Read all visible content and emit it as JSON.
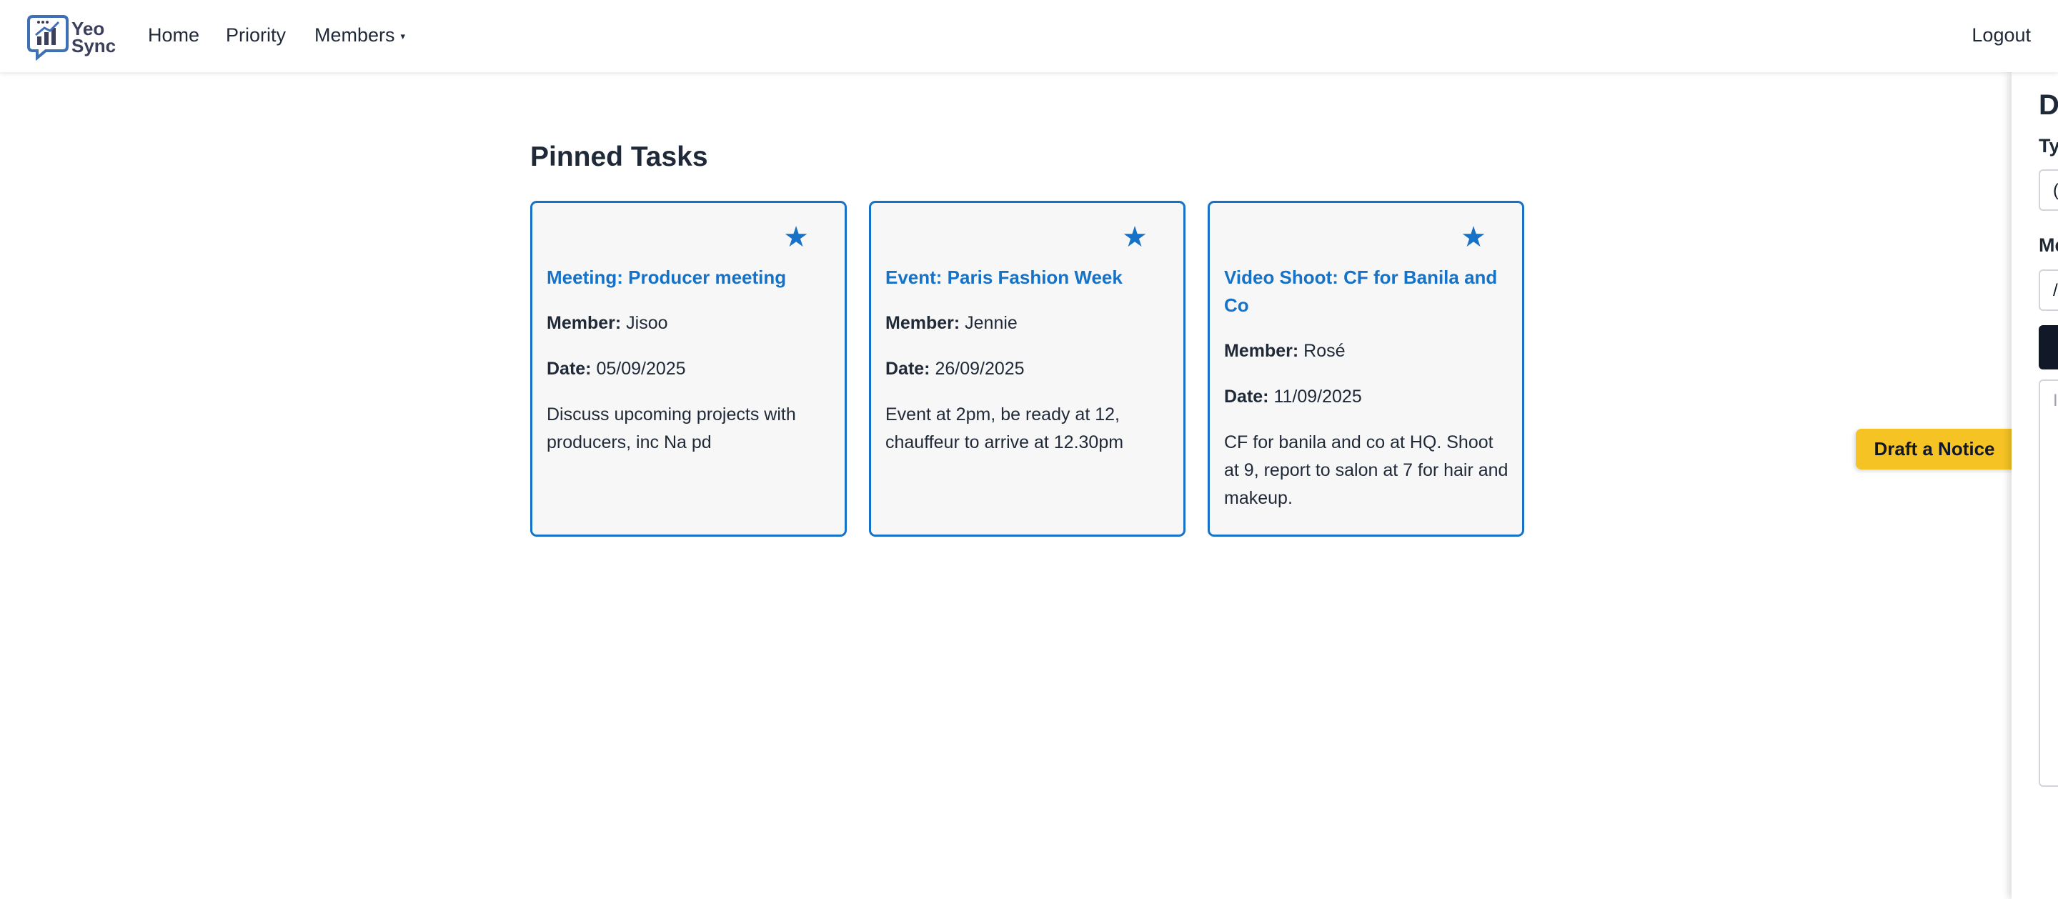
{
  "brand": {
    "logo_text_line1": "Yeo",
    "logo_text_line2": "Sync"
  },
  "nav": {
    "home": "Home",
    "priority": "Priority",
    "members": "Members",
    "members_caret": "▾",
    "logout": "Logout"
  },
  "main": {
    "section_title": "Pinned Tasks",
    "cards": [
      {
        "title": "Meeting: Producer meeting",
        "member_label": "Member:",
        "member": "Jisoo",
        "date_label": "Date:",
        "date": "05/09/2025",
        "description": "Discuss upcoming projects with producers, inc Na pd",
        "star": "★"
      },
      {
        "title": "Event: Paris Fashion Week",
        "member_label": "Member:",
        "member": "Jennie",
        "date_label": "Date:",
        "date": "26/09/2025",
        "description": "Event at 2pm, be ready at 12, chauffeur to arrive at 12.30pm",
        "star": "★"
      },
      {
        "title": "Video Shoot: CF for Banila and Co",
        "member_label": "Member:",
        "member": "Rosé",
        "date_label": "Date:",
        "date": "11/09/2025",
        "description": "CF for banila and co at HQ. Shoot at 9, report to salon at 7 for hair and makeup.",
        "star": "★"
      }
    ]
  },
  "draft_tab": {
    "label": "Draft a Notice"
  },
  "side_panel": {
    "heading_visible": "D",
    "type_label_visible": "Ty",
    "type_value_visible": "(",
    "member_label_visible": "Me",
    "member_value_visible": "/",
    "textarea_visible": "I"
  },
  "colors": {
    "accent": "#1672c7",
    "draft_tab": "#f6c324",
    "panel_button": "#111827"
  }
}
